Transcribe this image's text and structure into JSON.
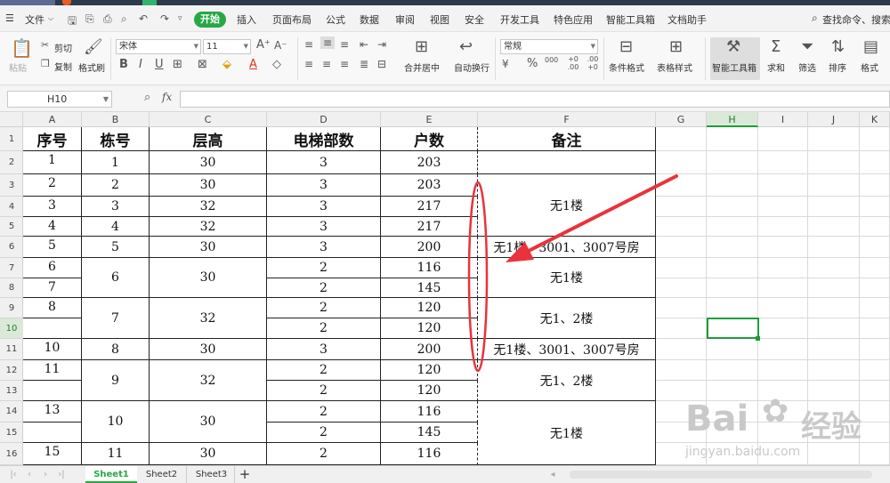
{
  "menu": {
    "file": "文件",
    "tabs": [
      "开始",
      "插入",
      "页面布局",
      "公式",
      "数据",
      "审阅",
      "视图",
      "安全",
      "开发工具",
      "特色应用",
      "智能工具箱",
      "文档助手"
    ],
    "search": "查找命令、搜索模"
  },
  "ribbon": {
    "paste": "粘贴",
    "cut": "剪切",
    "copy": "复制",
    "format_painter": "格式刷",
    "font_name": "宋体",
    "font_size": "11",
    "merge_center": "合并居中",
    "wrap_text": "自动换行",
    "number_format": "常规",
    "percent": "%",
    "thousands": "000",
    "inc_decimal": "+0 .00",
    "dec_decimal": ".00 +0",
    "cond_format": "条件格式",
    "table_style": "表格样式",
    "smart_toolbox": "智能工具箱",
    "sum": "求和",
    "filter": "筛选",
    "sort": "排序",
    "format": "格式"
  },
  "formula_bar": {
    "name_box": "H10",
    "fx": "fx",
    "value": ""
  },
  "columns": [
    "A",
    "B",
    "C",
    "D",
    "E",
    "F",
    "G",
    "H",
    "I",
    "J",
    "K"
  ],
  "rows": [
    "1",
    "2",
    "3",
    "4",
    "5",
    "6",
    "7",
    "8",
    "9",
    "10",
    "11",
    "12",
    "13",
    "14",
    "15",
    "16"
  ],
  "headers": {
    "a": "序号",
    "b": "栋号",
    "c": "层高",
    "d": "电梯部数",
    "e": "户数",
    "f": "备注"
  },
  "table": {
    "a": [
      "1",
      "2",
      "3",
      "4",
      "5",
      "6",
      "7",
      "8",
      "",
      "10",
      "11",
      "",
      "13",
      "",
      "15"
    ],
    "b": [
      "1",
      "2",
      "3",
      "4",
      "5",
      "6",
      "7",
      "8",
      "9",
      "10",
      "11"
    ],
    "c": [
      "30",
      "30",
      "32",
      "32",
      "30",
      "30",
      "32",
      "30",
      "32",
      "30",
      "30"
    ],
    "d": [
      "3",
      "3",
      "3",
      "3",
      "3",
      "2",
      "2",
      "2",
      "2",
      "3",
      "2",
      "2",
      "2",
      "2",
      "2"
    ],
    "e": [
      "203",
      "203",
      "217",
      "217",
      "200",
      "116",
      "145",
      "120",
      "120",
      "200",
      "120",
      "120",
      "116",
      "145",
      "116"
    ],
    "f": [
      "无1楼",
      "无1楼、3001、3007号房",
      "无1楼",
      "无1、2楼",
      "无1楼、3001、3007号房",
      "无1、2楼",
      "无1楼"
    ]
  },
  "sheets": [
    "Sheet1",
    "Sheet2",
    "Sheet3"
  ],
  "watermark": {
    "brand": "Bai",
    "brand2": "经验",
    "url": "jingyan.baidu.com"
  },
  "colors": {
    "accent": "#27a844",
    "annotation": "#e8333c"
  }
}
